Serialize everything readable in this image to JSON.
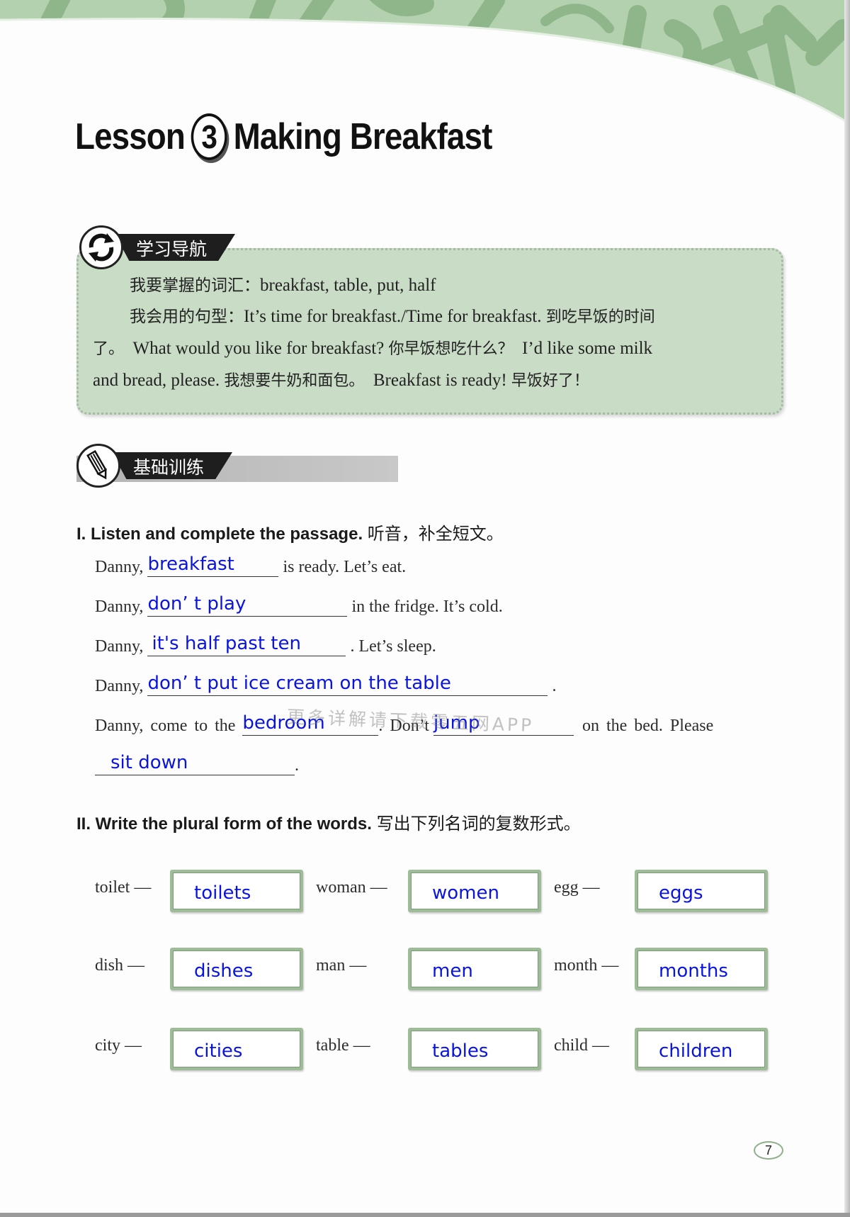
{
  "lesson": {
    "prefix": "Lesson",
    "number": "3",
    "title": "Making Breakfast"
  },
  "guide": {
    "tab_label": "学习导航",
    "icon": "refresh-arrows-icon",
    "vocab_label": "我要掌握的词汇：",
    "vocab_words": "breakfast, table, put, half",
    "sentence_label": "我会用的句型：",
    "sentence_1": "It’s time for breakfast./Time for breakfast.",
    "sentence_1_cn": "到吃早饭的时间",
    "sentence_1_cn_end": "了。",
    "sentence_2": "What would you like for breakfast?",
    "sentence_2_cn": "你早饭想吃什么？",
    "sentence_3_a": "I’d like some milk",
    "sentence_3_b": "and bread, please.",
    "sentence_3_cn": "我想要牛奶和面包。",
    "sentence_4": "Breakfast is ready!",
    "sentence_4_cn": "早饭好了！"
  },
  "basics": {
    "tab_label": "基础训练",
    "icon": "pencil-icon"
  },
  "section1": {
    "title": "I. Listen and complete the passage.",
    "title_cn": "听音，补全短文。",
    "lines": [
      {
        "before": "Danny,",
        "answer": "breakfast",
        "after": "is ready. Let’s eat."
      },
      {
        "before": "Danny,",
        "answer": "don’  t play",
        "after": "in the fridge. It’s cold."
      },
      {
        "before": "Danny,",
        "answer": "it's half past ten",
        "after": ". Let’s sleep."
      },
      {
        "before": "Danny,",
        "answer": "don’  t put ice cream on the table",
        "after": "."
      }
    ],
    "line5": {
      "before": "Danny, come to the",
      "answer_1": "bedroom",
      "middle": ". Don’t",
      "answer_2": "jump",
      "after": "on the bed. Please"
    },
    "line6": {
      "answer": "sit down",
      "after": "."
    }
  },
  "watermark": "更多详解请下载零五网APP",
  "section2": {
    "title": "II. Write the plural form of the words.",
    "title_cn": "写出下列名词的复数形式。",
    "items": [
      {
        "word": "toilet —",
        "answer": "toilets"
      },
      {
        "word": "woman —",
        "answer": "women"
      },
      {
        "word": "egg —",
        "answer": "eggs"
      },
      {
        "word": "dish —",
        "answer": "dishes"
      },
      {
        "word": "man —",
        "answer": "men"
      },
      {
        "word": "month —",
        "answer": "months"
      },
      {
        "word": "city —",
        "answer": "cities"
      },
      {
        "word": "table —",
        "answer": "tables"
      },
      {
        "word": "child —",
        "answer": "children"
      }
    ]
  },
  "page_number": "7",
  "colors": {
    "answer_ink": "#0a14e0",
    "guide_bg": "#c9dcc6",
    "banner_green": "#a9c9a4"
  }
}
